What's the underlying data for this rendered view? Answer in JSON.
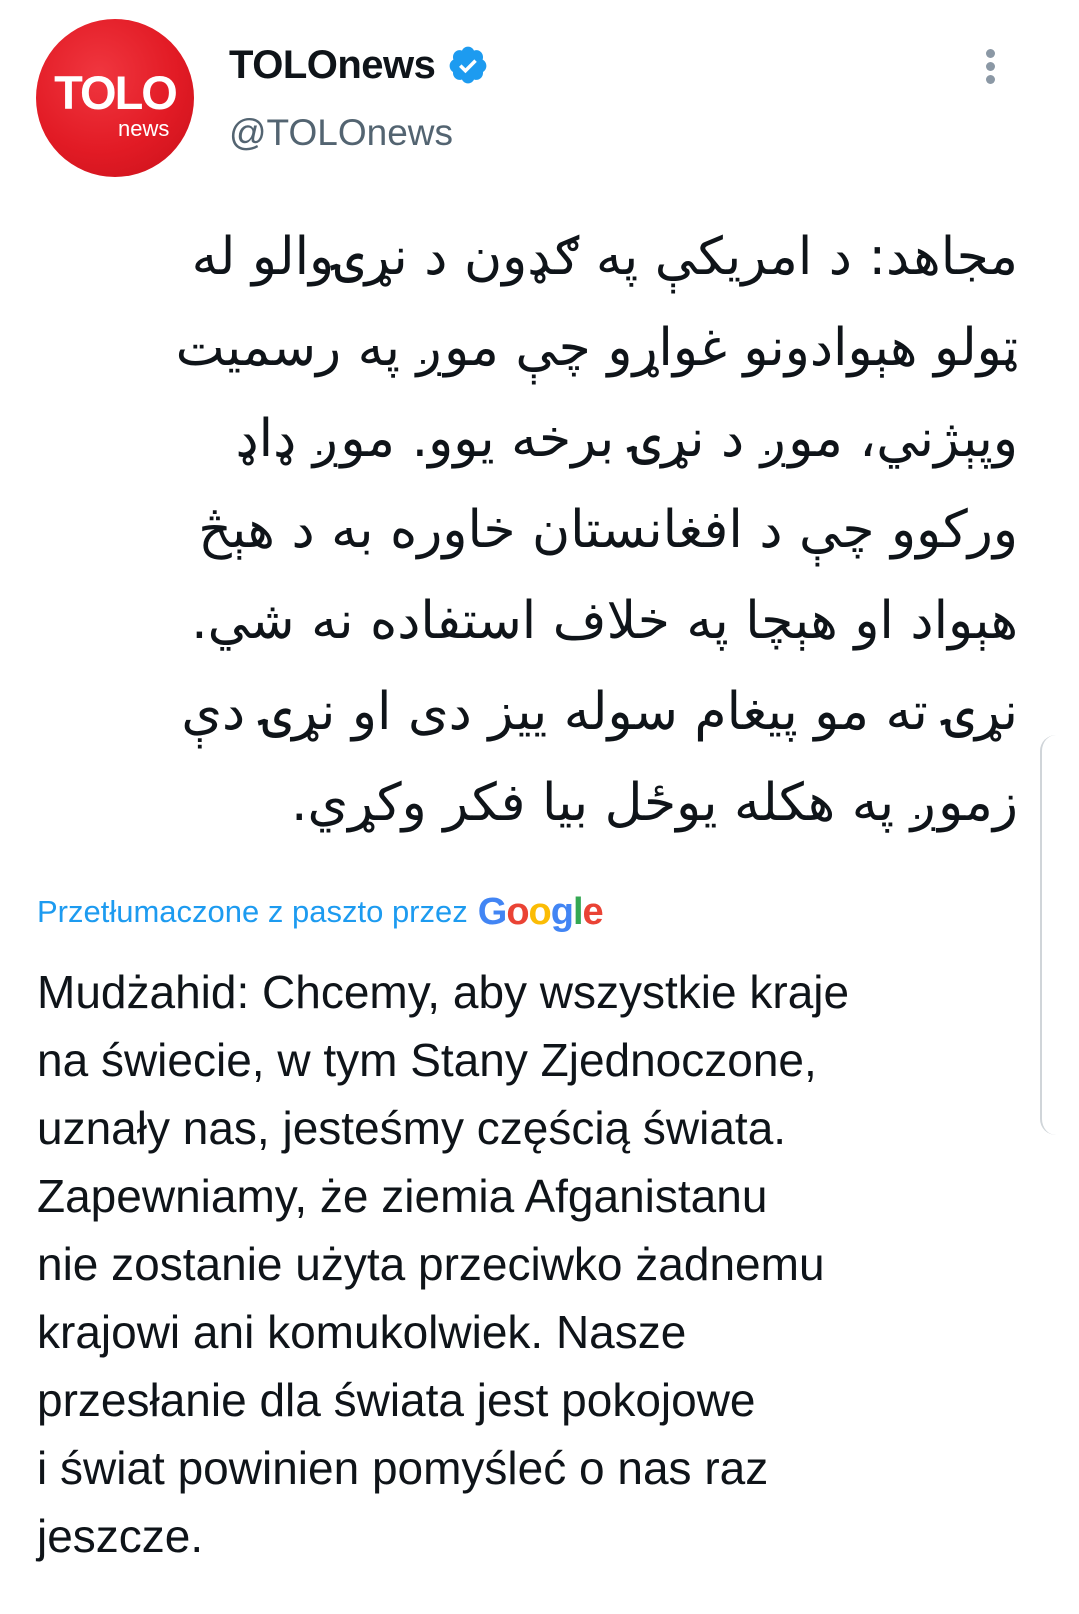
{
  "account": {
    "display_name": "TOLOnews",
    "handle": "@TOLOnews",
    "verified": true,
    "avatar_logo_main": "TOLO",
    "avatar_logo_sub": "news",
    "avatar_color": "#e21b25",
    "verified_icon": "verified-badge-icon",
    "verified_color": "#1d9bf0"
  },
  "menu": {
    "icon": "more-vertical-icon"
  },
  "tweet": {
    "original_lines": [
      "مجاهد: د امریکې په ګډون د نړۍوالو له",
      "ټولو هېوادونو غواړو چې موږ په رسمیت",
      "وپېژني، موږ د نړۍ برخه یوو. موږ ډاډ",
      "ورکوو چې د افغانستان خاوره به د هېڅ",
      "هېواد او هېچا په خلاف استفاده نه شي.",
      "نړۍ ته مو پیغام سوله ییز دی او نړۍ دې",
      "زموږ په هکله یوځل بیا فکر وکړي."
    ],
    "translated_label": "Przetłumaczone z paszto przez",
    "translation_provider": "Google",
    "translation_lines": [
      "Mudżahid: Chcemy, aby wszystkie kraje",
      "na świecie, w tym Stany Zjednoczone,",
      "uznały nas, jesteśmy częścią świata.",
      "Zapewniamy, że ziemia Afganistanu",
      "nie zostanie użyta przeciwko żadnemu",
      "krajowi ani komukolwiek. Nasze",
      "przesłanie dla świata jest pokojowe",
      "i świat powinien pomyśleć o nas raz",
      "jeszcze."
    ]
  },
  "colors": {
    "text": "#0f1419",
    "secondary_text": "#536471",
    "link": "#1d9bf0"
  }
}
